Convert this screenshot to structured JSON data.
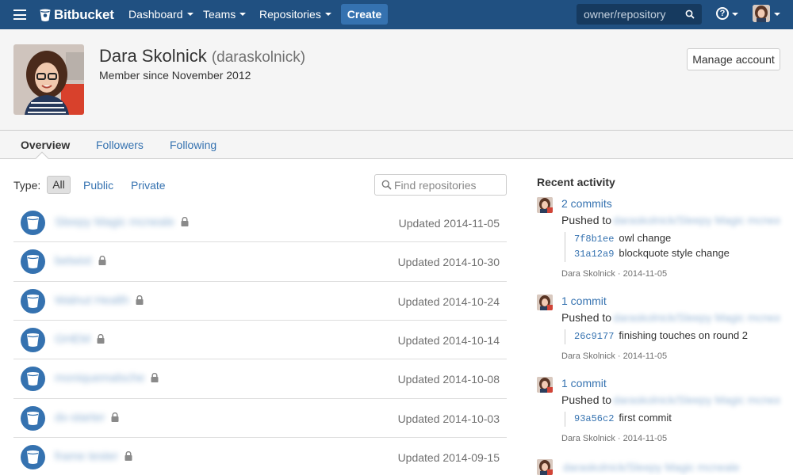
{
  "nav": {
    "brand": "Bitbucket",
    "items": [
      {
        "label": "Dashboard"
      },
      {
        "label": "Teams"
      },
      {
        "label": "Repositories"
      }
    ],
    "create_label": "Create",
    "search_placeholder": "owner/repository",
    "help_label": "?"
  },
  "profile": {
    "display_name": "Dara Skolnick",
    "username": "(daraskolnick)",
    "member_since": "Member since November 2012",
    "manage_label": "Manage account"
  },
  "tabs": [
    {
      "label": "Overview"
    },
    {
      "label": "Followers"
    },
    {
      "label": "Following"
    }
  ],
  "filters": {
    "type_label": "Type:",
    "options": [
      {
        "label": "All"
      },
      {
        "label": "Public"
      },
      {
        "label": "Private"
      }
    ],
    "find_placeholder": "Find repositories"
  },
  "repos": [
    {
      "name": "Sleepy Magic mcneale",
      "updated": "Updated 2014-11-05"
    },
    {
      "name": "betwixt",
      "updated": "Updated 2014-10-30"
    },
    {
      "name": "Walnut Health",
      "updated": "Updated 2014-10-24"
    },
    {
      "name": "GHEM",
      "updated": "Updated 2014-10-14"
    },
    {
      "name": "moniquemalsche",
      "updated": "Updated 2014-10-08"
    },
    {
      "name": "dx-starter",
      "updated": "Updated 2014-10-03"
    },
    {
      "name": "frame tester",
      "updated": "Updated 2014-09-15"
    }
  ],
  "activity": {
    "title": "Recent activity",
    "entries": [
      {
        "commits_label": "2 commits",
        "pushed_label": "Pushed to",
        "target": "daraskolnick/Sleepy Magic mcneale",
        "commits": [
          {
            "hash": "7f8b1ee",
            "message": "owl change"
          },
          {
            "hash": "31a12a9",
            "message": "blockquote style change"
          }
        ],
        "meta": "Dara Skolnick · 2014-11-05"
      },
      {
        "commits_label": "1 commit",
        "pushed_label": "Pushed to",
        "target": "daraskolnick/Sleepy Magic mcneale",
        "commits": [
          {
            "hash": "26c9177",
            "message": "finishing touches on round 2"
          }
        ],
        "meta": "Dara Skolnick · 2014-11-05"
      },
      {
        "commits_label": "1 commit",
        "pushed_label": "Pushed to",
        "target": "daraskolnick/Sleepy Magic mcneale",
        "commits": [
          {
            "hash": "93a56c2",
            "message": "first commit"
          }
        ],
        "meta": "Dara Skolnick · 2014-11-05"
      },
      {
        "commits_label": "",
        "pushed_label": "",
        "target": "daraskolnick/Sleepy Magic mcneale",
        "commits": [],
        "meta": ""
      }
    ]
  },
  "colors": {
    "nav_bg": "#205081",
    "accent": "#3572b0",
    "link": "#3572b0",
    "avatar_badge": "#d04437"
  }
}
